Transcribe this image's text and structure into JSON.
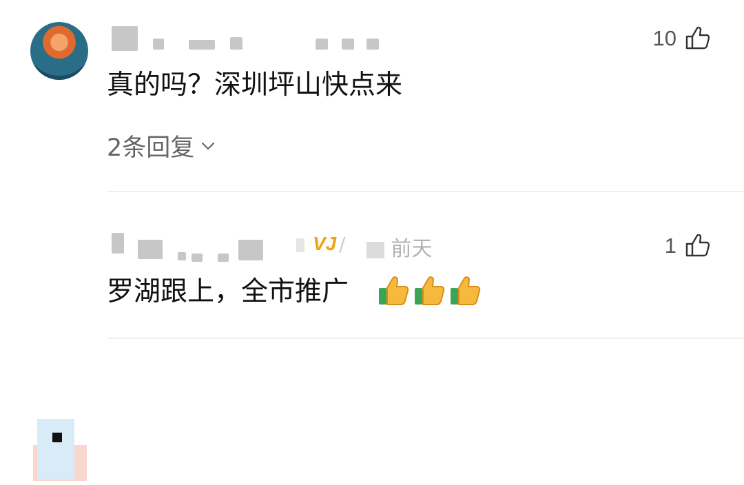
{
  "comments": [
    {
      "text": "真的吗？深圳坪山快点来",
      "likes": "10",
      "replies_label": "2条回复"
    },
    {
      "time": "前天",
      "text": "罗湖跟上，全市推广",
      "likes": "1",
      "emoji_icons": [
        "thumbs-up-emoji-icon",
        "thumbs-up-emoji-icon",
        "thumbs-up-emoji-icon"
      ]
    }
  ],
  "colors": {
    "text": "#111111",
    "secondary_text": "#666666",
    "muted_text": "#b3b3b3",
    "divider": "#efefef",
    "vip_accent": "#f2a20a"
  }
}
